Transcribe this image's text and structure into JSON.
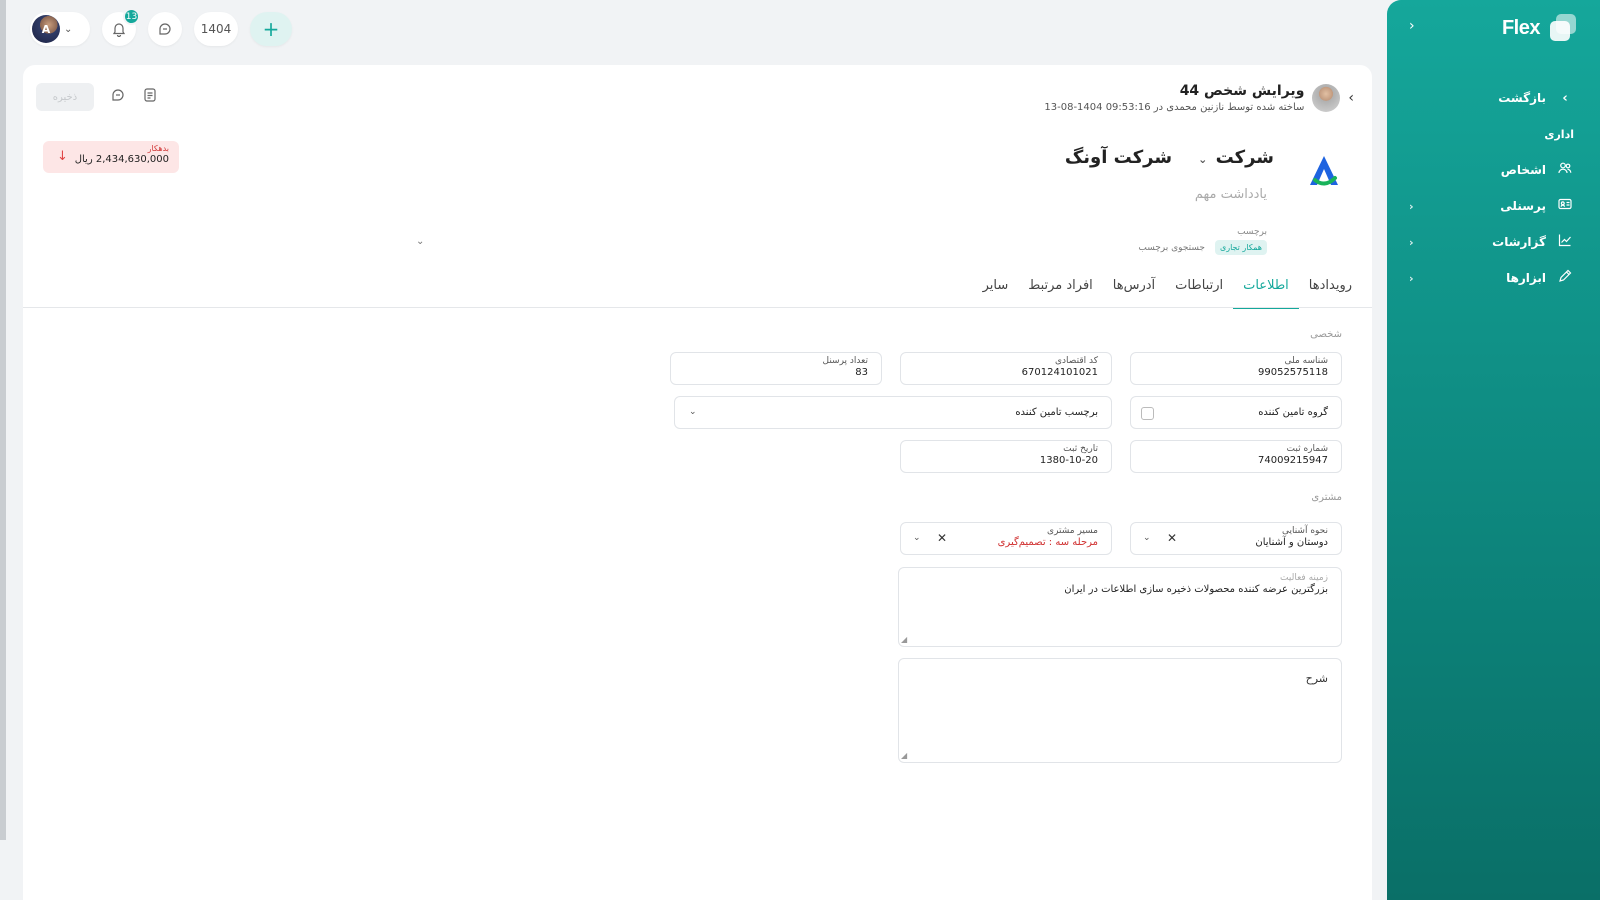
{
  "sidebar": {
    "logo_text": "Flex",
    "collapse_icon": "‹",
    "back_label": "بازگشت",
    "section_label": "اداری",
    "items": [
      {
        "label": "اشخاص",
        "icon": "users-icon",
        "has_arrow": false
      },
      {
        "label": "پرسنلی",
        "icon": "id-card-icon",
        "has_arrow": true
      },
      {
        "label": "گزارشات",
        "icon": "chart-line-icon",
        "has_arrow": true
      },
      {
        "label": "ابزارها",
        "icon": "pencil-icon",
        "has_arrow": true
      }
    ]
  },
  "topbar": {
    "avatar_initial": "A",
    "notifications_count": "13",
    "year": "1404",
    "add_label": "+"
  },
  "header": {
    "title": "ویرایش شخص 44",
    "subtitle": "ساخته شده توسط نازنین محمدی در 09:53:16 1404-08-13",
    "save_label": "ذخیره"
  },
  "balance": {
    "label": "بدهکار",
    "amount": "2,434,630,000 ریال"
  },
  "company": {
    "type": "شرکت",
    "name": "شرکت آونگ",
    "note_placeholder": "یادداشت مهم",
    "tag_label": "برچسب",
    "tags": [
      "همکار تجاری"
    ],
    "tag_search": "جستجوی برچسب"
  },
  "tabs": [
    "رویدادها",
    "اطلاعات",
    "ارتباطات",
    "آدرس‌ها",
    "افراد مرتبط",
    "سایر"
  ],
  "active_tab": "اطلاعات",
  "personal": {
    "section_title": "شخصی",
    "national_id": {
      "label": "شناسه ملی",
      "value": "99052575118"
    },
    "economic_code": {
      "label": "کد اقتصادی",
      "value": "670124101021"
    },
    "staff_count": {
      "label": "تعداد پرسنل",
      "value": "83"
    },
    "supplier_group": {
      "label": "گروه تامین کننده"
    },
    "supplier_tag": {
      "label": "برچسب تامین کننده"
    },
    "reg_number": {
      "label": "شماره ثبت",
      "value": "74009215947"
    },
    "reg_date": {
      "label": "تاریخ ثبت",
      "value": "1380-10-20"
    }
  },
  "customer": {
    "section_title": "مشتری",
    "acquaintance": {
      "label": "نحوه آشنایی",
      "value": "دوستان و آشنایان"
    },
    "customer_path": {
      "label": "مسیر مشتری",
      "value": "مرحله سه : تصمیم‌گیری"
    },
    "activity": {
      "label": "زمینه فعالیت",
      "value": "بزرگترین عرضه کننده محصولات ذخیره سازی اطلاعات در ایران"
    },
    "description_placeholder": "شرح"
  },
  "colors": {
    "accent": "#14a89b",
    "danger": "#d02f2f",
    "sidebar_top": "#15a79b",
    "sidebar_bottom": "#0a6f67"
  }
}
